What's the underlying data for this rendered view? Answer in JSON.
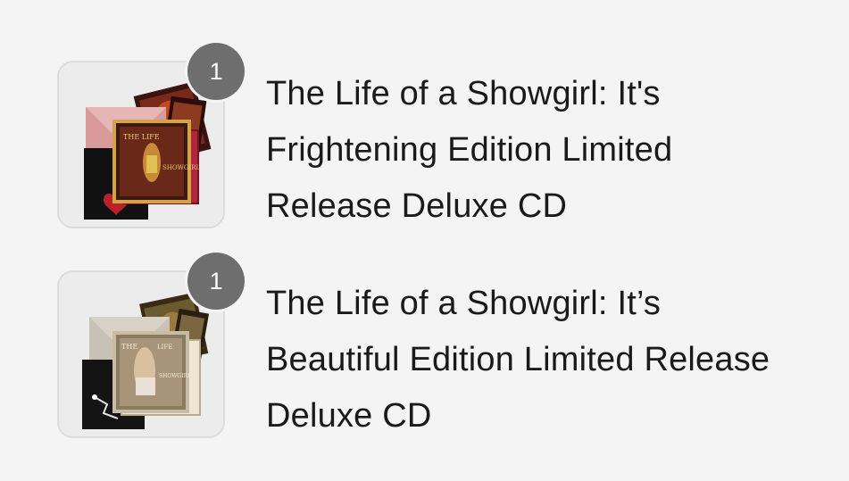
{
  "colors": {
    "page_background": "#f4f4f4",
    "badge_background": "#6e6e6e",
    "title_text": "#1a1a1a",
    "thumb_border": "#dcdcdc"
  },
  "order_items": [
    {
      "quantity": "1",
      "title_lines": [
        "The Life of a Showgirl: It's",
        "Frightening Edition Limited",
        "Release Deluxe CD"
      ],
      "thumbnail_icon": "album-cd-bundle-image"
    },
    {
      "quantity": "1",
      "title_lines": [
        "The Life of a Showgirl: It’s",
        "Beautiful Edition Limited Release",
        "Deluxe CD"
      ],
      "thumbnail_icon": "album-cd-bundle-image"
    }
  ]
}
